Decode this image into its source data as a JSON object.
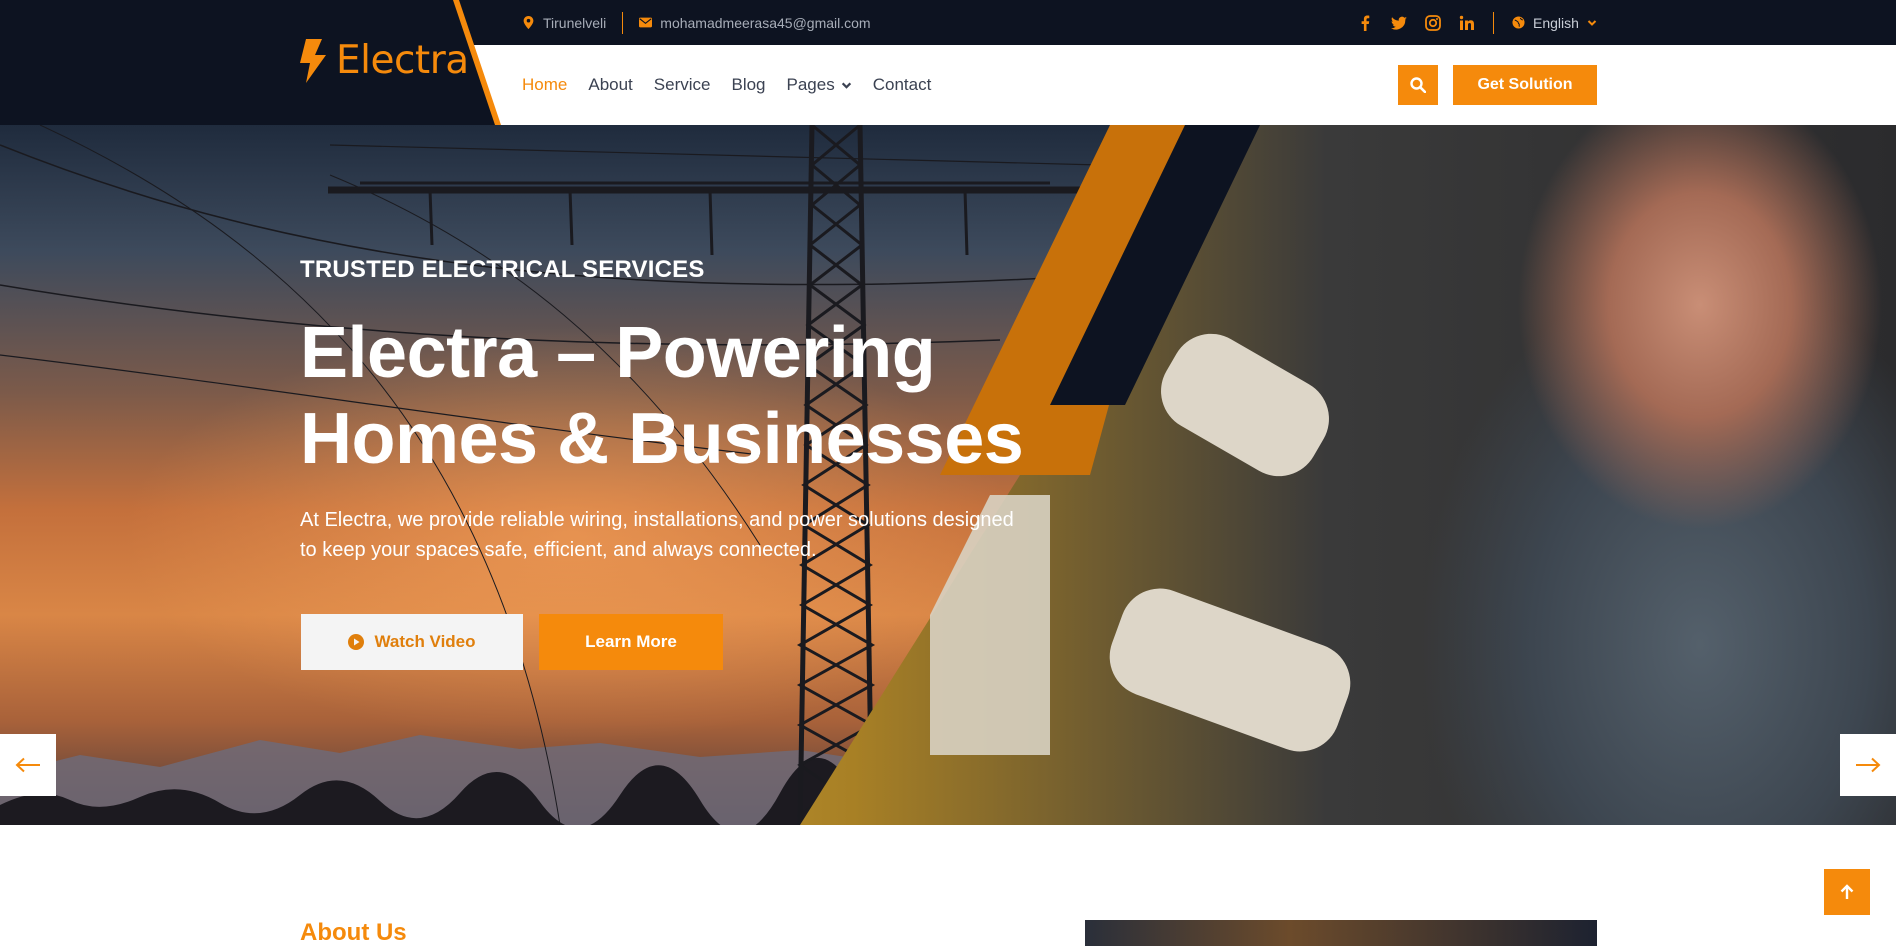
{
  "brand": {
    "name": "Electra",
    "accent_color": "#f58a0c",
    "dark_color": "#0d1321"
  },
  "topbar": {
    "location": "Tirunelveli",
    "email": "mohamadmeerasa45@gmail.com",
    "social_icons": [
      "facebook-icon",
      "twitter-icon",
      "instagram-icon",
      "linkedin-icon"
    ],
    "language": "English"
  },
  "nav": {
    "items": [
      {
        "label": "Home",
        "active": true
      },
      {
        "label": "About"
      },
      {
        "label": "Service"
      },
      {
        "label": "Blog"
      },
      {
        "label": "Pages",
        "has_dropdown": true
      },
      {
        "label": "Contact"
      }
    ],
    "cta_label": "Get Solution"
  },
  "hero": {
    "eyebrow": "TRUSTED ELECTRICAL SERVICES",
    "title": "Electra – Powering Homes & Businesses",
    "subtitle": "At Electra, we provide reliable wiring, installations, and power solutions designed to keep your spaces safe, efficient, and always connected.",
    "watch_video_label": "Watch Video",
    "learn_more_label": "Learn More"
  },
  "about": {
    "title": "About Us"
  }
}
